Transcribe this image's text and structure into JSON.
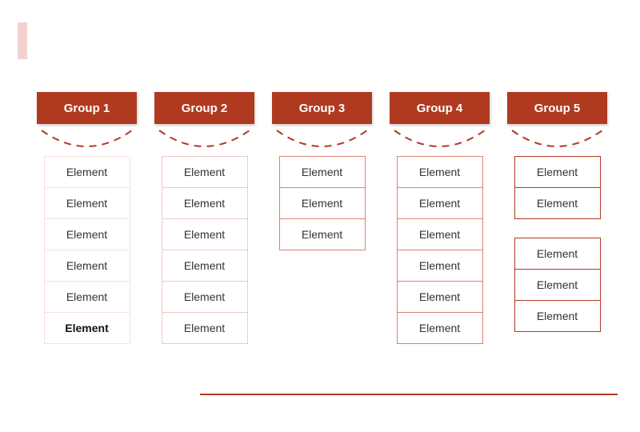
{
  "accent_color": "#b03a20",
  "groups": [
    {
      "label": "Group 1",
      "sections": [
        {
          "items": [
            {
              "text": "Element",
              "border": "faint"
            },
            {
              "text": "Element",
              "border": "faint"
            },
            {
              "text": "Element",
              "border": "faint"
            },
            {
              "text": "Element",
              "border": "faint"
            },
            {
              "text": "Element",
              "border": "faint"
            },
            {
              "text": "Element",
              "border": "faint",
              "bold": true
            }
          ]
        }
      ]
    },
    {
      "label": "Group 2",
      "sections": [
        {
          "items": [
            {
              "text": "Element",
              "border": "light"
            },
            {
              "text": "Element",
              "border": "light"
            },
            {
              "text": "Element",
              "border": "light"
            },
            {
              "text": "Element",
              "border": "light"
            },
            {
              "text": "Element",
              "border": "light"
            },
            {
              "text": "Element",
              "border": "light"
            }
          ]
        }
      ]
    },
    {
      "label": "Group 3",
      "sections": [
        {
          "items": [
            {
              "text": "Element",
              "border": "med"
            },
            {
              "text": "Element",
              "border": "med"
            },
            {
              "text": "Element",
              "border": "med"
            }
          ]
        }
      ]
    },
    {
      "label": "Group 4",
      "sections": [
        {
          "items": [
            {
              "text": "Element",
              "border": "med"
            },
            {
              "text": "Element",
              "border": "med"
            },
            {
              "text": "Element",
              "border": "med"
            },
            {
              "text": "Element",
              "border": "med"
            },
            {
              "text": "Element",
              "border": "med"
            },
            {
              "text": "Element",
              "border": "med"
            }
          ]
        }
      ]
    },
    {
      "label": "Group 5",
      "sections": [
        {
          "items": [
            {
              "text": "Element",
              "border": "full"
            },
            {
              "text": "Element",
              "border": "full"
            }
          ]
        },
        {
          "items": [
            {
              "text": "Element",
              "border": "full"
            },
            {
              "text": "Element",
              "border": "full"
            },
            {
              "text": "Element",
              "border": "full"
            }
          ]
        }
      ]
    }
  ]
}
